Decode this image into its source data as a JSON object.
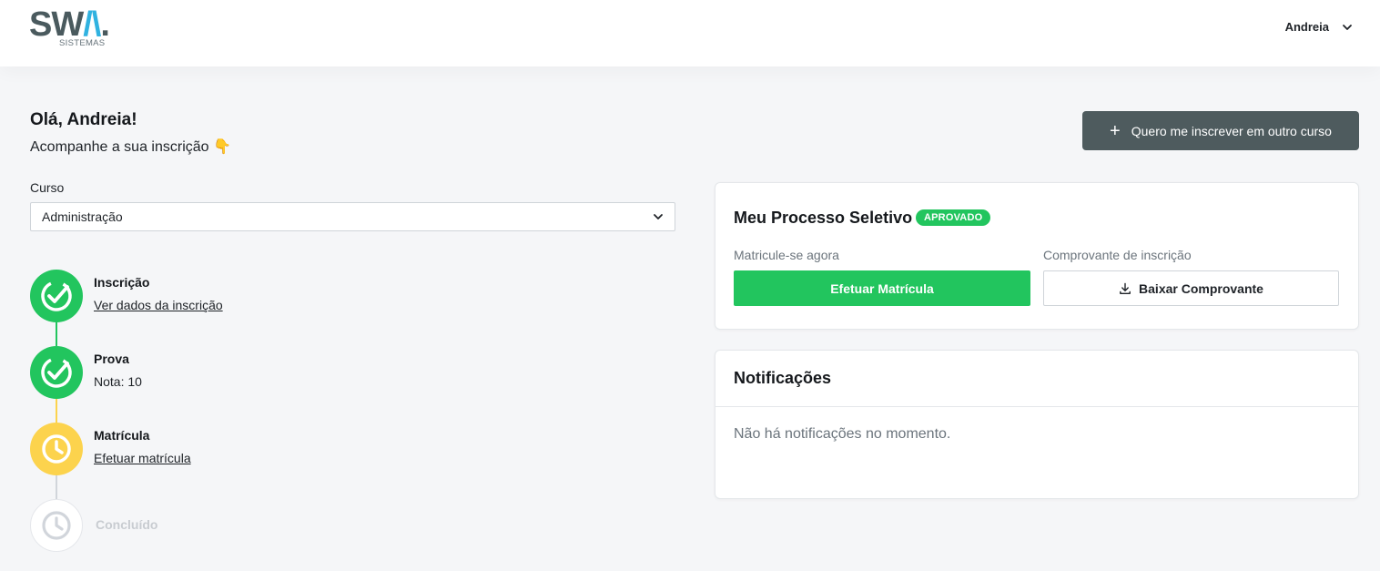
{
  "header": {
    "logo_main": "SW",
    "logo_accent": "/\\",
    "logo_dot": ".",
    "logo_sub": "SISTEMAS",
    "user_name": "Andreia"
  },
  "greeting": {
    "title": "Olá, Andreia!",
    "subtitle": "Acompanhe a sua inscrição 👇"
  },
  "actions": {
    "other_course": "Quero me inscrever em outro curso"
  },
  "course": {
    "label": "Curso",
    "selected": "Administração"
  },
  "steps": [
    {
      "title": "Inscrição",
      "detail": "Ver dados da inscrição",
      "status": "done",
      "icon": "check-icon"
    },
    {
      "title": "Prova",
      "detail": "Nota: 10",
      "status": "done",
      "icon": "check-icon"
    },
    {
      "title": "Matrícula",
      "detail": "Efetuar matrícula",
      "status": "pending",
      "icon": "clock-icon"
    },
    {
      "title": "Concluído",
      "detail": "",
      "status": "inactive",
      "icon": "clock-icon"
    }
  ],
  "process_card": {
    "title": "Meu Processo Seletivo",
    "badge": "APROVADO",
    "enroll_label": "Matricule-se agora",
    "enroll_button": "Efetuar Matrícula",
    "receipt_label": "Comprovante de inscrição",
    "receipt_button": "Baixar Comprovante"
  },
  "notifications": {
    "title": "Notificações",
    "empty": "Não há notificações no momento."
  },
  "colors": {
    "green": "#22c55e",
    "yellow": "#fcd34d",
    "gray": "#d1d5db",
    "dark_button": "#4e5b5e",
    "logo_accent": "#30b2e0"
  }
}
